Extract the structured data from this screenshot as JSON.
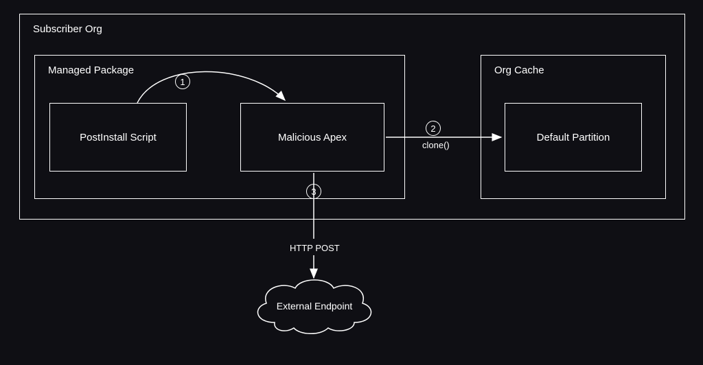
{
  "outer": {
    "title": "Subscriber Org"
  },
  "package": {
    "title": "Managed Package"
  },
  "cache": {
    "title": "Org Cache"
  },
  "nodes": {
    "postinstall": "PostInstall Script",
    "malicious": "Malicious Apex",
    "partition": "Default Partition",
    "endpoint": "External Endpoint"
  },
  "steps": {
    "one": "1",
    "two": "2",
    "three": "3"
  },
  "edges": {
    "clone": "clone()",
    "http": "HTTP POST"
  }
}
